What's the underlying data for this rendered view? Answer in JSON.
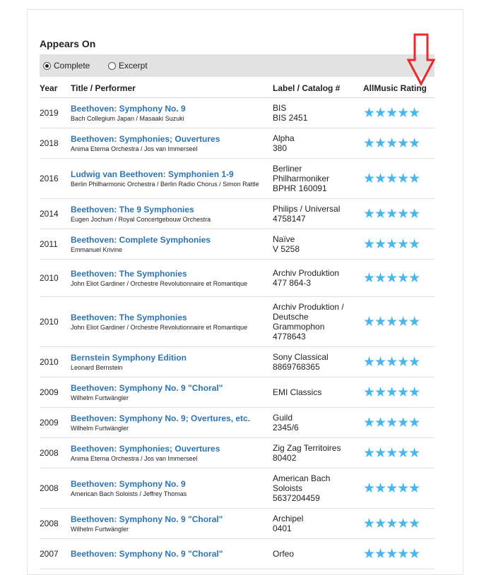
{
  "section_title": "Appears On",
  "filters": {
    "complete": "Complete",
    "excerpt": "Excerpt",
    "selected": "complete"
  },
  "columns": {
    "year": "Year",
    "title": "Title / Performer",
    "label": "Label / Catalog #",
    "rating": "AllMusic Rating"
  },
  "star_glyph": "★★★★★",
  "accent_colors": {
    "link": "#2c74b4",
    "star": "#46b6ef",
    "arrow": "#e8282b"
  },
  "rows": [
    {
      "year": "2019",
      "title": "Beethoven: Symphony No. 9",
      "performer": "Bach Collegium Japan / Masaaki Suzuki",
      "label_lines": [
        "BIS",
        "BIS 2451"
      ],
      "rating": 5
    },
    {
      "year": "2018",
      "title": "Beethoven: Symphonies; Ouvertures",
      "performer": "Anima Eterna Orchestra / Jos van Immerseel",
      "label_lines": [
        "Alpha",
        "380"
      ],
      "rating": 5
    },
    {
      "year": "2016",
      "title": "Ludwig van Beethoven: Symphonien 1-9",
      "performer": "Berlin Philharmonic Orchestra / Berlin Radio Chorus / Simon Rattle",
      "label_lines": [
        "Berliner",
        "Philharmoniker",
        "BPHR 160091"
      ],
      "rating": 5
    },
    {
      "year": "2014",
      "title": "Beethoven: The 9 Symphonies",
      "performer": "Eugen Jochum / Royal Concertgebouw Orchestra",
      "label_lines": [
        "Philips / Universal",
        "4758147"
      ],
      "rating": 5
    },
    {
      "year": "2011",
      "title": "Beethoven: Complete Symphonies",
      "performer": "Emmanuel Krivine",
      "label_lines": [
        "Naïve",
        "V 5258"
      ],
      "rating": 5
    },
    {
      "year": "2010",
      "title": "Beethoven: The Symphonies",
      "performer": "John Eliot Gardiner / Orchestre Revolutionnaire et Romantique",
      "label_lines": [
        "Archiv Produktion",
        "477 864-3"
      ],
      "rating": 5
    },
    {
      "year": "2010",
      "title": "Beethoven: The Symphonies",
      "performer": "John Eliot Gardiner / Orchestre Revolutionnaire et Romantique",
      "label_lines": [
        "Archiv Produktion /",
        "Deutsche",
        "Grammophon",
        "4778643"
      ],
      "rating": 5
    },
    {
      "year": "2010",
      "title": "Bernstein Symphony Edition",
      "performer": "Leonard Bernstein",
      "label_lines": [
        "Sony Classical",
        "8869768365"
      ],
      "rating": 5
    },
    {
      "year": "2009",
      "title": "Beethoven: Symphony No. 9 \"Choral\"",
      "performer": "Wilhelm Furtwängler",
      "label_lines": [
        "EMI Classics"
      ],
      "rating": 5
    },
    {
      "year": "2009",
      "title": "Beethoven: Symphony No. 9; Overtures, etc.",
      "performer": "Wilhelm Furtwängler",
      "label_lines": [
        "Guild",
        "2345/6"
      ],
      "rating": 5
    },
    {
      "year": "2008",
      "title": "Beethoven: Symphonies; Ouvertures",
      "performer": "Anima Eterna Orchestra / Jos van Immerseel",
      "label_lines": [
        "Zig Zag Territoires",
        "80402"
      ],
      "rating": 5
    },
    {
      "year": "2008",
      "title": "Beethoven: Symphony No. 9",
      "performer": "American Bach Soloists / Jeffrey Thomas",
      "label_lines": [
        "American Bach",
        "Soloists",
        "5637204459"
      ],
      "rating": 5
    },
    {
      "year": "2008",
      "title": "Beethoven: Symphony No. 9 \"Choral\"",
      "performer": "Wilhelm Furtwängler",
      "label_lines": [
        "Archipel",
        "0401"
      ],
      "rating": 5
    },
    {
      "year": "2007",
      "title": "Beethoven: Symphony No. 9 \"Choral\"",
      "performer": "",
      "label_lines": [
        "Orfeo"
      ],
      "rating": 5
    }
  ]
}
